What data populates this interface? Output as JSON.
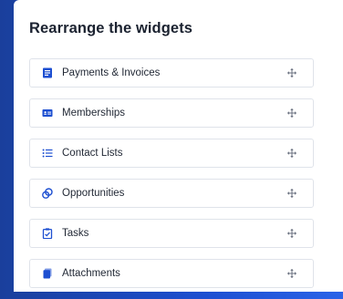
{
  "panel": {
    "title": "Rearrange the widgets"
  },
  "widgets": [
    {
      "label": "Payments & Invoices",
      "icon": "invoice-icon"
    },
    {
      "label": "Memberships",
      "icon": "membership-card-icon"
    },
    {
      "label": "Contact Lists",
      "icon": "list-icon"
    },
    {
      "label": "Opportunities",
      "icon": "opportunity-icon"
    },
    {
      "label": "Tasks",
      "icon": "clipboard-icon"
    },
    {
      "label": "Attachments",
      "icon": "attachment-icon"
    }
  ],
  "colors": {
    "accent": "#1d4fd1",
    "background": "#1d4fd1",
    "panel": "#ffffff",
    "border": "#dfe3ea"
  },
  "handle_icon": "drag-move-icon"
}
